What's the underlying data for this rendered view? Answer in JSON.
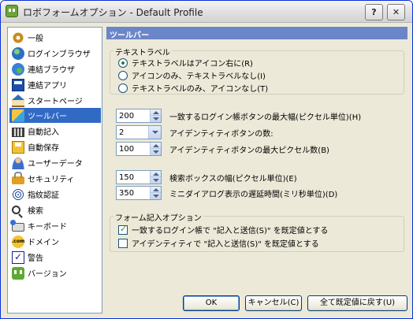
{
  "window": {
    "title": "ロボフォームオプション - Default Profile",
    "help_glyph": "?",
    "close_glyph": "✕"
  },
  "sidebar": {
    "items": [
      {
        "label": "一般",
        "icon": "gear-icon"
      },
      {
        "label": "ログインブラウザ",
        "icon": "globe-icon"
      },
      {
        "label": "連結ブラウザ",
        "icon": "globe-icon"
      },
      {
        "label": "連結アプリ",
        "icon": "app-window-icon"
      },
      {
        "label": "スタートページ",
        "icon": "home-icon"
      },
      {
        "label": "ツールバー",
        "icon": "toolbar-icon",
        "selected": true
      },
      {
        "label": "自動記入",
        "icon": "keypad-icon"
      },
      {
        "label": "自動保存",
        "icon": "disk-icon"
      },
      {
        "label": "ユーザーデータ",
        "icon": "user-icon"
      },
      {
        "label": "セキュリティ",
        "icon": "lock-icon"
      },
      {
        "label": "指紋認証",
        "icon": "fingerprint-icon"
      },
      {
        "label": "検索",
        "icon": "search-icon"
      },
      {
        "label": "キーボード",
        "icon": "keyboard-icon"
      },
      {
        "label": "ドメイン",
        "icon": "domain-icon",
        "glyph": ".com"
      },
      {
        "label": "警告",
        "icon": "warning-check-icon"
      },
      {
        "label": "バージョン",
        "icon": "roboform-icon"
      }
    ]
  },
  "panel": {
    "header": "ツールバー",
    "text_labels": {
      "title": "テキストラベル",
      "options": [
        {
          "label": "テキストラベルはアイコン右に(R)",
          "selected": true
        },
        {
          "label": "アイコンのみ、テキストラベルなし(I)",
          "selected": false
        },
        {
          "label": "テキストラベルのみ、アイコンなし(T)",
          "selected": false
        }
      ]
    },
    "fields": {
      "max_login_width": {
        "value": "200",
        "label": "一致するログイン帳ボタンの最大幅(ピクセル単位)(H)"
      },
      "identity_count": {
        "value": "2",
        "label": "アイデンティティボタンの数:"
      },
      "identity_max_width": {
        "value": "100",
        "label": "アイデンティティボタンの最大ピクセル数(B)"
      },
      "search_width": {
        "value": "150",
        "label": "検索ボックスの幅(ピクセル単位)(E)"
      },
      "mini_dialog_delay": {
        "value": "350",
        "label": "ミニダイアログ表示の遅延時間(ミリ秒単位)(D)"
      }
    },
    "form_fill": {
      "title": "フォーム記入オプション",
      "options": [
        {
          "label": "一致するログイン帳で \"記入と送信(S)\" を既定値とする",
          "checked": true
        },
        {
          "label": "アイデンティティで \"記入と送信(S)\" を既定値とする",
          "checked": false
        }
      ]
    }
  },
  "buttons": {
    "ok": "OK",
    "cancel": "キャンセル(C)",
    "reset": "全て既定値に戻す(U)"
  },
  "colors": {
    "header_bg": "#6b86c8",
    "selected_bg": "#316ac5",
    "window_bg": "#ece9d8"
  }
}
